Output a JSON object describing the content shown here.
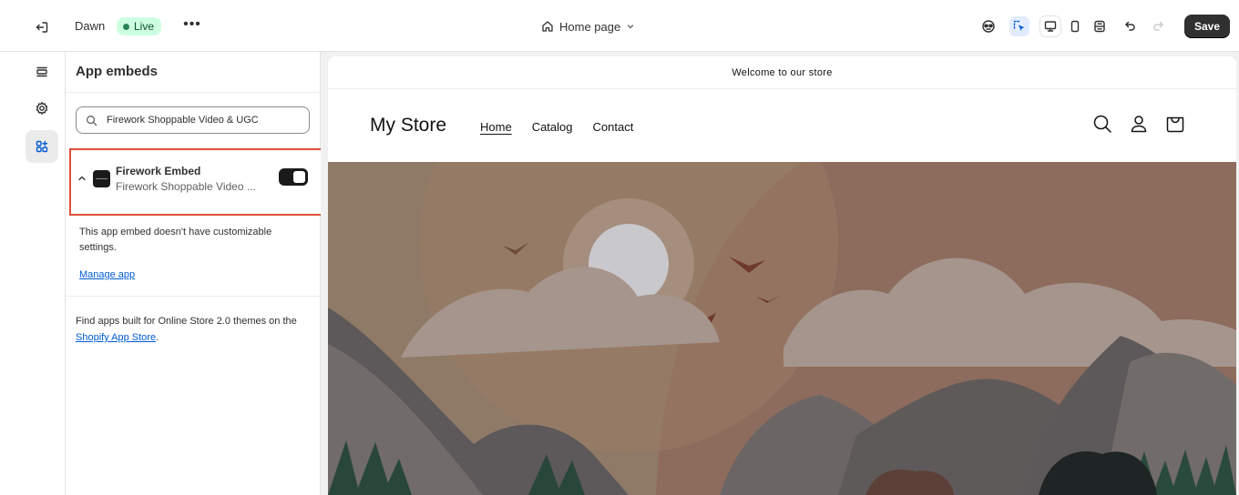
{
  "topbar": {
    "theme_name": "Dawn",
    "status_badge": "Live",
    "more_label": "•••",
    "page_selector": "Home page",
    "save_label": "Save"
  },
  "panel": {
    "title": "App embeds",
    "search_value": "Firework Shoppable Video & UGC",
    "embed": {
      "name": "Firework Embed",
      "subtitle": "Firework Shoppable Video ...",
      "enabled": true
    },
    "no_settings_text": "This app embed doesn't have customizable settings.",
    "manage_link": "Manage app",
    "find_apps_prefix": "Find apps built for Online Store 2.0 themes on the ",
    "find_apps_link": "Shopify App Store",
    "find_apps_suffix": "."
  },
  "preview": {
    "announcement": "Welcome to our store",
    "store_name": "My Store",
    "nav": [
      "Home",
      "Catalog",
      "Contact"
    ]
  },
  "colors": {
    "accent_blue": "#005bd3",
    "highlight_border": "#e04e3a",
    "live_bg": "#cdfee1",
    "save_bg": "#303030"
  }
}
